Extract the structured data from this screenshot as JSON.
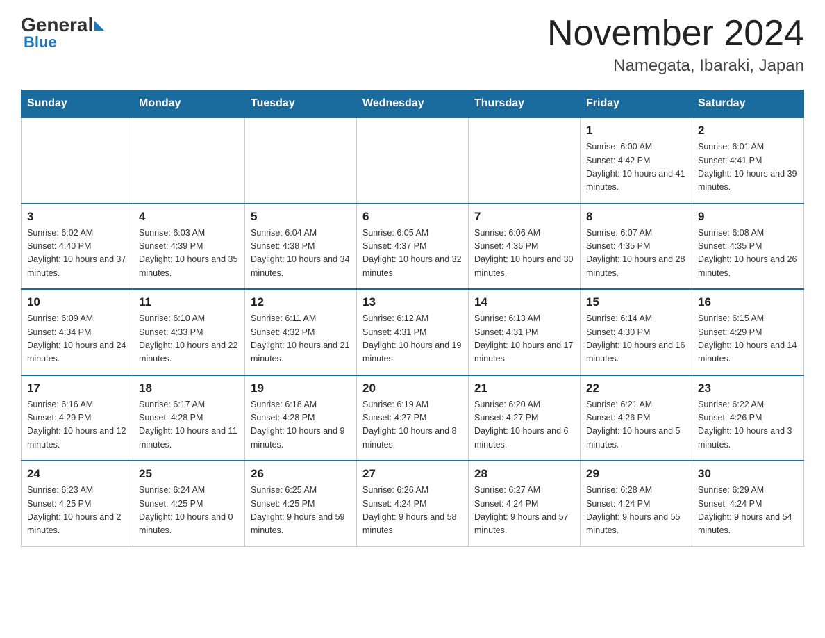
{
  "header": {
    "logo_general": "General",
    "logo_blue": "Blue",
    "month_title": "November 2024",
    "location": "Namegata, Ibaraki, Japan"
  },
  "days_of_week": [
    "Sunday",
    "Monday",
    "Tuesday",
    "Wednesday",
    "Thursday",
    "Friday",
    "Saturday"
  ],
  "weeks": [
    [
      {
        "day": "",
        "info": ""
      },
      {
        "day": "",
        "info": ""
      },
      {
        "day": "",
        "info": ""
      },
      {
        "day": "",
        "info": ""
      },
      {
        "day": "",
        "info": ""
      },
      {
        "day": "1",
        "info": "Sunrise: 6:00 AM\nSunset: 4:42 PM\nDaylight: 10 hours and 41 minutes."
      },
      {
        "day": "2",
        "info": "Sunrise: 6:01 AM\nSunset: 4:41 PM\nDaylight: 10 hours and 39 minutes."
      }
    ],
    [
      {
        "day": "3",
        "info": "Sunrise: 6:02 AM\nSunset: 4:40 PM\nDaylight: 10 hours and 37 minutes."
      },
      {
        "day": "4",
        "info": "Sunrise: 6:03 AM\nSunset: 4:39 PM\nDaylight: 10 hours and 35 minutes."
      },
      {
        "day": "5",
        "info": "Sunrise: 6:04 AM\nSunset: 4:38 PM\nDaylight: 10 hours and 34 minutes."
      },
      {
        "day": "6",
        "info": "Sunrise: 6:05 AM\nSunset: 4:37 PM\nDaylight: 10 hours and 32 minutes."
      },
      {
        "day": "7",
        "info": "Sunrise: 6:06 AM\nSunset: 4:36 PM\nDaylight: 10 hours and 30 minutes."
      },
      {
        "day": "8",
        "info": "Sunrise: 6:07 AM\nSunset: 4:35 PM\nDaylight: 10 hours and 28 minutes."
      },
      {
        "day": "9",
        "info": "Sunrise: 6:08 AM\nSunset: 4:35 PM\nDaylight: 10 hours and 26 minutes."
      }
    ],
    [
      {
        "day": "10",
        "info": "Sunrise: 6:09 AM\nSunset: 4:34 PM\nDaylight: 10 hours and 24 minutes."
      },
      {
        "day": "11",
        "info": "Sunrise: 6:10 AM\nSunset: 4:33 PM\nDaylight: 10 hours and 22 minutes."
      },
      {
        "day": "12",
        "info": "Sunrise: 6:11 AM\nSunset: 4:32 PM\nDaylight: 10 hours and 21 minutes."
      },
      {
        "day": "13",
        "info": "Sunrise: 6:12 AM\nSunset: 4:31 PM\nDaylight: 10 hours and 19 minutes."
      },
      {
        "day": "14",
        "info": "Sunrise: 6:13 AM\nSunset: 4:31 PM\nDaylight: 10 hours and 17 minutes."
      },
      {
        "day": "15",
        "info": "Sunrise: 6:14 AM\nSunset: 4:30 PM\nDaylight: 10 hours and 16 minutes."
      },
      {
        "day": "16",
        "info": "Sunrise: 6:15 AM\nSunset: 4:29 PM\nDaylight: 10 hours and 14 minutes."
      }
    ],
    [
      {
        "day": "17",
        "info": "Sunrise: 6:16 AM\nSunset: 4:29 PM\nDaylight: 10 hours and 12 minutes."
      },
      {
        "day": "18",
        "info": "Sunrise: 6:17 AM\nSunset: 4:28 PM\nDaylight: 10 hours and 11 minutes."
      },
      {
        "day": "19",
        "info": "Sunrise: 6:18 AM\nSunset: 4:28 PM\nDaylight: 10 hours and 9 minutes."
      },
      {
        "day": "20",
        "info": "Sunrise: 6:19 AM\nSunset: 4:27 PM\nDaylight: 10 hours and 8 minutes."
      },
      {
        "day": "21",
        "info": "Sunrise: 6:20 AM\nSunset: 4:27 PM\nDaylight: 10 hours and 6 minutes."
      },
      {
        "day": "22",
        "info": "Sunrise: 6:21 AM\nSunset: 4:26 PM\nDaylight: 10 hours and 5 minutes."
      },
      {
        "day": "23",
        "info": "Sunrise: 6:22 AM\nSunset: 4:26 PM\nDaylight: 10 hours and 3 minutes."
      }
    ],
    [
      {
        "day": "24",
        "info": "Sunrise: 6:23 AM\nSunset: 4:25 PM\nDaylight: 10 hours and 2 minutes."
      },
      {
        "day": "25",
        "info": "Sunrise: 6:24 AM\nSunset: 4:25 PM\nDaylight: 10 hours and 0 minutes."
      },
      {
        "day": "26",
        "info": "Sunrise: 6:25 AM\nSunset: 4:25 PM\nDaylight: 9 hours and 59 minutes."
      },
      {
        "day": "27",
        "info": "Sunrise: 6:26 AM\nSunset: 4:24 PM\nDaylight: 9 hours and 58 minutes."
      },
      {
        "day": "28",
        "info": "Sunrise: 6:27 AM\nSunset: 4:24 PM\nDaylight: 9 hours and 57 minutes."
      },
      {
        "day": "29",
        "info": "Sunrise: 6:28 AM\nSunset: 4:24 PM\nDaylight: 9 hours and 55 minutes."
      },
      {
        "day": "30",
        "info": "Sunrise: 6:29 AM\nSunset: 4:24 PM\nDaylight: 9 hours and 54 minutes."
      }
    ]
  ]
}
